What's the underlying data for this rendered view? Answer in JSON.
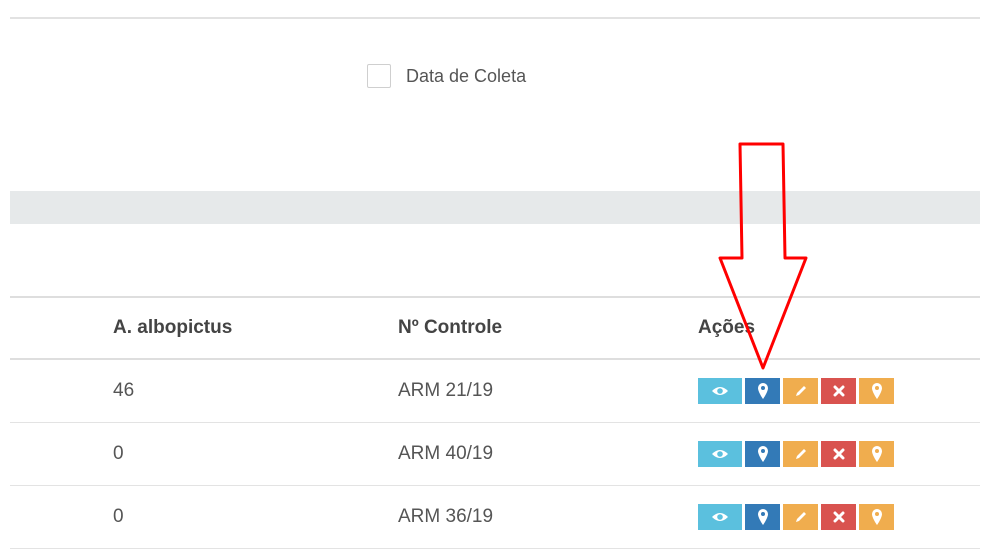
{
  "filter": {
    "checkbox_label": "Data de Coleta",
    "checked": false
  },
  "table": {
    "headers": [
      "A. albopictus",
      "Nº Controle",
      "Ações"
    ],
    "rows": [
      {
        "albopictus": "46",
        "controle": "ARM 21/19"
      },
      {
        "albopictus": "0",
        "controle": "ARM 40/19"
      },
      {
        "albopictus": "0",
        "controle": "ARM 36/19"
      }
    ],
    "action_icons": [
      "eye-icon",
      "map-marker-icon",
      "pencil-icon",
      "times-icon",
      "map-pin-icon"
    ]
  },
  "colors": {
    "view": "#5bc0de",
    "map": "#337ab7",
    "edit": "#f0ad4e",
    "delete": "#d9534f",
    "pin": "#f0ad4e",
    "annotation_arrow": "#ff0000"
  }
}
